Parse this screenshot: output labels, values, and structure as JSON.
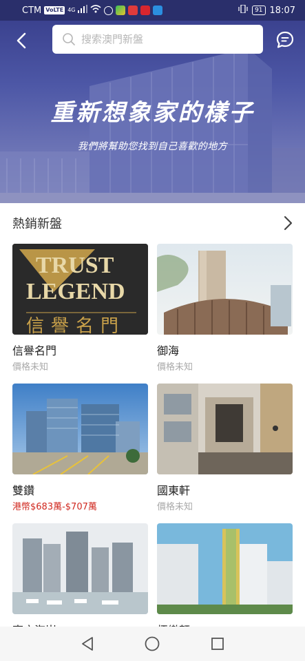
{
  "status_bar": {
    "carrier": "CTM",
    "volte": "VoLTE",
    "network": "4G",
    "battery": "91",
    "time": "18:07"
  },
  "header": {
    "search_placeholder": "搜索澳門新盤",
    "hero_title": "重新想象家的樣子",
    "hero_subtitle": "我們將幫助您找到自己喜歡的地方"
  },
  "section": {
    "title": "熱銷新盤"
  },
  "listings": [
    {
      "name": "信譽名門",
      "price": "價格未知",
      "price_known": false,
      "image_text_en1": "TRUST",
      "image_text_en2": "LEGEND",
      "image_text_zh": "信譽名門"
    },
    {
      "name": "御海",
      "price": "價格未知",
      "price_known": false
    },
    {
      "name": "雙鑽",
      "price": "港幣$683萬-$707萬",
      "price_known": true
    },
    {
      "name": "國東軒",
      "price": "價格未知",
      "price_known": false
    },
    {
      "name": "東方海岸",
      "price": ""
    },
    {
      "name": "栢樂軒",
      "price": ""
    }
  ],
  "colors": {
    "status_bg": "#2a2f6b",
    "price_red": "#d0281f",
    "price_grey": "#a9a9a9"
  }
}
